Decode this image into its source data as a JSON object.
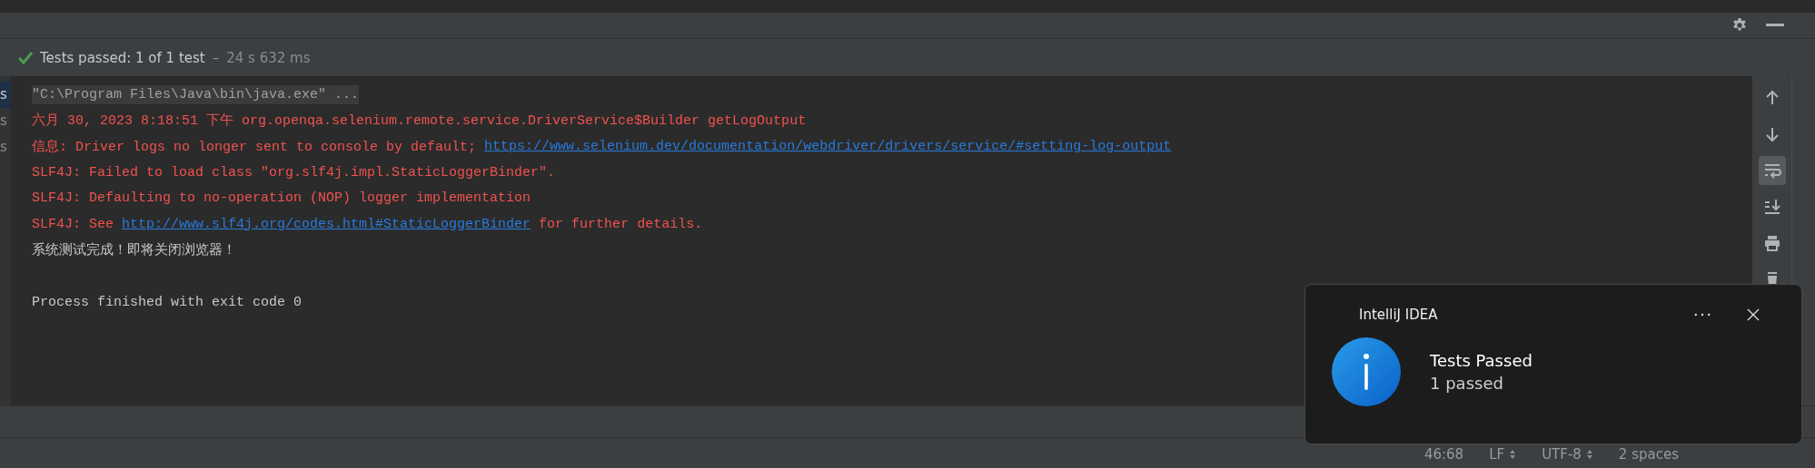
{
  "test_status": {
    "passed": true,
    "summary": "Tests passed: 1 of 1 test",
    "separator": "–",
    "duration": "24 s 632 ms"
  },
  "gutter": [
    {
      "label": "s",
      "selected": true
    },
    {
      "label": "s",
      "selected": false
    },
    {
      "label": "s",
      "selected": false
    }
  ],
  "console_lines": [
    {
      "kind": "command",
      "segments": [
        {
          "text": "\"C:\\Program Files\\Java\\bin\\java.exe\" ...",
          "link": false
        }
      ]
    },
    {
      "kind": "error",
      "segments": [
        {
          "text": "六月 30, 2023 8:18:51 下午 org.openqa.selenium.remote.service.DriverService$Builder getLogOutput",
          "link": false
        }
      ]
    },
    {
      "kind": "error",
      "segments": [
        {
          "text": "信息: Driver logs no longer sent to console by default; ",
          "link": false
        },
        {
          "text": "https://www.selenium.dev/documentation/webdriver/drivers/service/#setting-log-output",
          "link": true
        }
      ]
    },
    {
      "kind": "error",
      "segments": [
        {
          "text": "SLF4J: Failed to load class \"org.slf4j.impl.StaticLoggerBinder\".",
          "link": false
        }
      ]
    },
    {
      "kind": "error",
      "segments": [
        {
          "text": "SLF4J: Defaulting to no-operation (NOP) logger implementation",
          "link": false
        }
      ]
    },
    {
      "kind": "error",
      "segments": [
        {
          "text": "SLF4J: See ",
          "link": false
        },
        {
          "text": "http://www.slf4j.org/codes.html#StaticLoggerBinder",
          "link": true
        },
        {
          "text": " for further details.",
          "link": false
        }
      ]
    },
    {
      "kind": "output",
      "segments": [
        {
          "text": "系统测试完成！即将关闭浏览器！",
          "link": false
        }
      ]
    },
    {
      "kind": "blank"
    },
    {
      "kind": "output",
      "segments": [
        {
          "text": "Process finished with exit code 0",
          "link": false
        }
      ]
    }
  ],
  "side_toolbar": [
    {
      "kind": "up",
      "selected": false
    },
    {
      "kind": "down",
      "selected": false
    },
    {
      "kind": "wrap",
      "selected": true
    },
    {
      "kind": "scroll-end",
      "selected": false
    },
    {
      "kind": "print",
      "selected": false
    },
    {
      "kind": "trash",
      "selected": false
    }
  ],
  "notification": {
    "app": "IntelliJ IDEA",
    "title": "Tests Passed",
    "body": "1 passed"
  },
  "status_bar": [
    {
      "text": "46:68",
      "dropdown": false
    },
    {
      "text": "LF",
      "dropdown": true
    },
    {
      "text": "UTF-8",
      "dropdown": true
    },
    {
      "text": "2 spaces",
      "dropdown": false
    }
  ]
}
